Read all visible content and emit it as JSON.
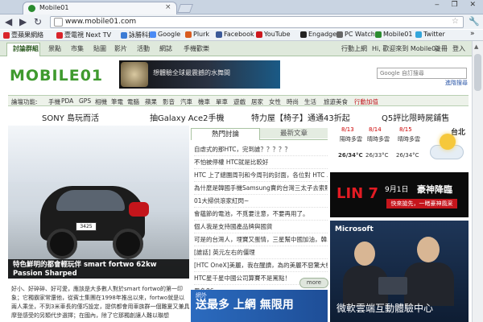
{
  "browser": {
    "tab_title": "Mobile01",
    "tab_close": "×",
    "window_controls": "‒ ❐ ✕",
    "url": "www.mobile01.com",
    "nav": {
      "back": "◀",
      "forward": "▶",
      "reload": "↻"
    },
    "star": "☆",
    "wrench": "🔧",
    "bookmarks": [
      {
        "label": "壹蘋果網絡",
        "color": "#d9242b"
      },
      {
        "label": "壹電視 Next TV",
        "color": "#d9242b"
      },
      {
        "label": "詠勝科技",
        "color": "#3a7bd5"
      },
      {
        "label": "Google",
        "color": "#4a8af4"
      },
      {
        "label": "Plurk",
        "color": "#d85b20"
      },
      {
        "label": "Facebook",
        "color": "#3b5998"
      },
      {
        "label": "YouTube",
        "color": "#cc181e"
      },
      {
        "label": "Engadget",
        "color": "#222222"
      },
      {
        "label": "PC Watch",
        "color": "#666666"
      },
      {
        "label": "Mobile01",
        "color": "#2a8b2f"
      },
      {
        "label": "Twitter",
        "color": "#33a6db"
      }
    ],
    "bookmarks_more": "»"
  },
  "site": {
    "nav_items": [
      "討論群組",
      "景點",
      "市集",
      "貼圖",
      "影片",
      "活動",
      "網誌",
      "手機歡樂"
    ],
    "right_nav": [
      "行動上網",
      "Hi, 歡迎來到 Mobile01",
      "註冊",
      "登入"
    ],
    "logo": "MOBILE01",
    "banner_text": "想體驗全球最震撼的水舞間",
    "search_placeholder": "Google 自訂搜尋",
    "advanced_search": "進階搜尋",
    "categories": [
      "論壇功能:",
      "手機",
      "PDA",
      "GPS",
      "相機",
      "筆電",
      "電腦",
      "蘋果",
      "影音",
      "汽車",
      "機車",
      "單車",
      "遊戲",
      "居家",
      "女性",
      "時尚",
      "生活",
      "旅遊美食",
      "行動加值"
    ],
    "headlines": [
      "SONY 島玩而活",
      "抽Galaxy Ace2手機",
      "特力屋【椅子】通通43折起",
      "Q5評比限時屍鋪售"
    ],
    "feature_caption": "特色鮮明的都會輕玩伴 smart fortwo 62kw Passion Sharped",
    "feature_plate": "3425",
    "feature_intro": "好小、好碎碎、好可愛，應該是大多數人對於smart fortwo的第一印象；它獨霸家常還他，從賓士集團在1998年推出以來，fortwo就是以兩人乘坐，不到3米車長的僅巧設定，提供都會用車族群一個難夏又兼具摩登感受的另類代步選擇；在國內，除了它那獨創讓人難以聯想",
    "tab_hot": "熱門討論",
    "tab_new": "最新文章",
    "hot_topics": [
      "自虐式的那HTC，完到誰？？？？？",
      "不怕被停權 HTC就是比較好",
      "HTC 上了總團周刊和今周刊的封面，各位對 HTC ...",
      "為什麼是韓國手機Samsung賣的台灣三太子去索賠？",
      "01大掃供滾家紅閃~",
      "會蘊節的電池，不覓要注意，不要再用了。",
      "個人我是支持國產品牌與國貨",
      "可是的台灣人，埋寶又蛋情，三星幫中國加油，韓...",
      "[誰話] 英元左右的僵理",
      "[HTC OneX]美麗，我在醒讀，為的美麗不惡驚大機...",
      "HTC星千星中國公司算賽不是罵點！",
      "黑色86"
    ],
    "more_button": "more",
    "ad_bottom_small": "網外",
    "ad_bottom_text": "送最多 上網 無限用",
    "weather": {
      "city": "台北",
      "days": [
        {
          "date": "8/13",
          "desc": "陽時多雲",
          "temp": "26/34°C"
        },
        {
          "date": "8/14",
          "desc": "晴時多雲",
          "temp": "26/33°C"
        },
        {
          "date": "8/15",
          "desc": "晴時多雲",
          "temp": "26/34°C"
        }
      ]
    },
    "ad_lin": {
      "logo": "LIN 7",
      "date": "9月1日",
      "title": "豪神降臨",
      "button": "快來搶先，一睹豪神風采"
    },
    "ad_ms": {
      "logo": "Microsoft",
      "title": "微軟雲端互動體驗中心"
    }
  }
}
